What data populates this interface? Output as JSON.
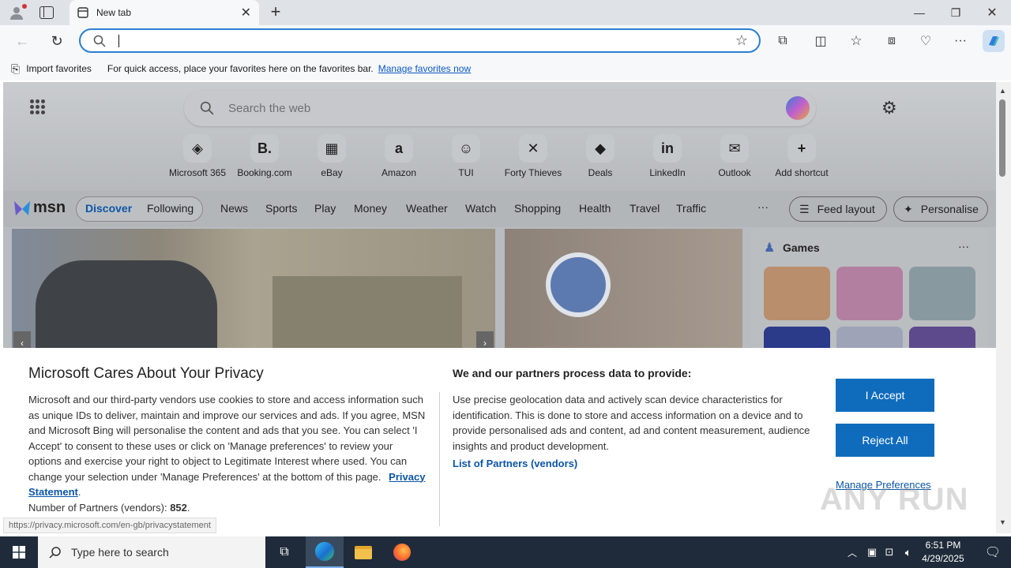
{
  "browser": {
    "tab_title": "New tab",
    "address_value": ""
  },
  "favorites_bar": {
    "import_label": "Import favorites",
    "message": "For quick access, place your favorites here on the favorites bar.",
    "manage_link": "Manage favorites now"
  },
  "newtab": {
    "search_placeholder": "Search the web",
    "shortcuts": [
      {
        "label": "Microsoft 365",
        "glyph": "◈"
      },
      {
        "label": "Booking.com",
        "glyph": "B."
      },
      {
        "label": "eBay",
        "glyph": "▦"
      },
      {
        "label": "Amazon",
        "glyph": "a"
      },
      {
        "label": "TUI",
        "glyph": "☺"
      },
      {
        "label": "Forty Thieves",
        "glyph": "✕"
      },
      {
        "label": "Deals",
        "glyph": "◆"
      },
      {
        "label": "LinkedIn",
        "glyph": "in"
      },
      {
        "label": "Outlook",
        "glyph": "✉"
      },
      {
        "label": "Add shortcut",
        "glyph": "+"
      }
    ]
  },
  "msn": {
    "logo": "msn",
    "tabs": [
      "Discover",
      "Following"
    ],
    "nav": [
      "News",
      "Sports",
      "Play",
      "Money",
      "Weather",
      "Watch",
      "Shopping",
      "Health",
      "Travel",
      "Traffic"
    ],
    "more": "···",
    "feed_layout": "Feed layout",
    "personalise": "Personalise",
    "games_title": "Games",
    "games_more": "···"
  },
  "privacy": {
    "title": "Microsoft Cares About Your Privacy",
    "body": "Microsoft and our third-party vendors use cookies to store and access information such as unique IDs to deliver, maintain and improve our services and ads. If you agree, MSN and Microsoft Bing will personalise the content and ads that you see. You can select 'I Accept' to consent to these uses or click on 'Manage preferences' to review your options and exercise your right to object to Legitimate Interest where used.  You can change your selection under 'Manage Preferences' at the bottom of this page.",
    "privacy_link": "Privacy Statement",
    "partners_count_label": "Number of Partners (vendors):",
    "partners_count": "852",
    "right_heading": "We and our partners process data to provide:",
    "right_body": "Use precise geolocation data and actively scan device characteristics for identification. This is done to store and access information on a device and to provide personalised ads and content, ad and content measurement, audience insights and product development.",
    "partners_link": "List of Partners (vendors)",
    "accept": "I Accept",
    "reject": "Reject All",
    "manage": "Manage Preferences"
  },
  "status_url": "https://privacy.microsoft.com/en-gb/privacystatement",
  "taskbar": {
    "search_placeholder": "Type here to search",
    "time": "6:51 PM",
    "date": "4/29/2025"
  },
  "watermark": "ANY RUN"
}
